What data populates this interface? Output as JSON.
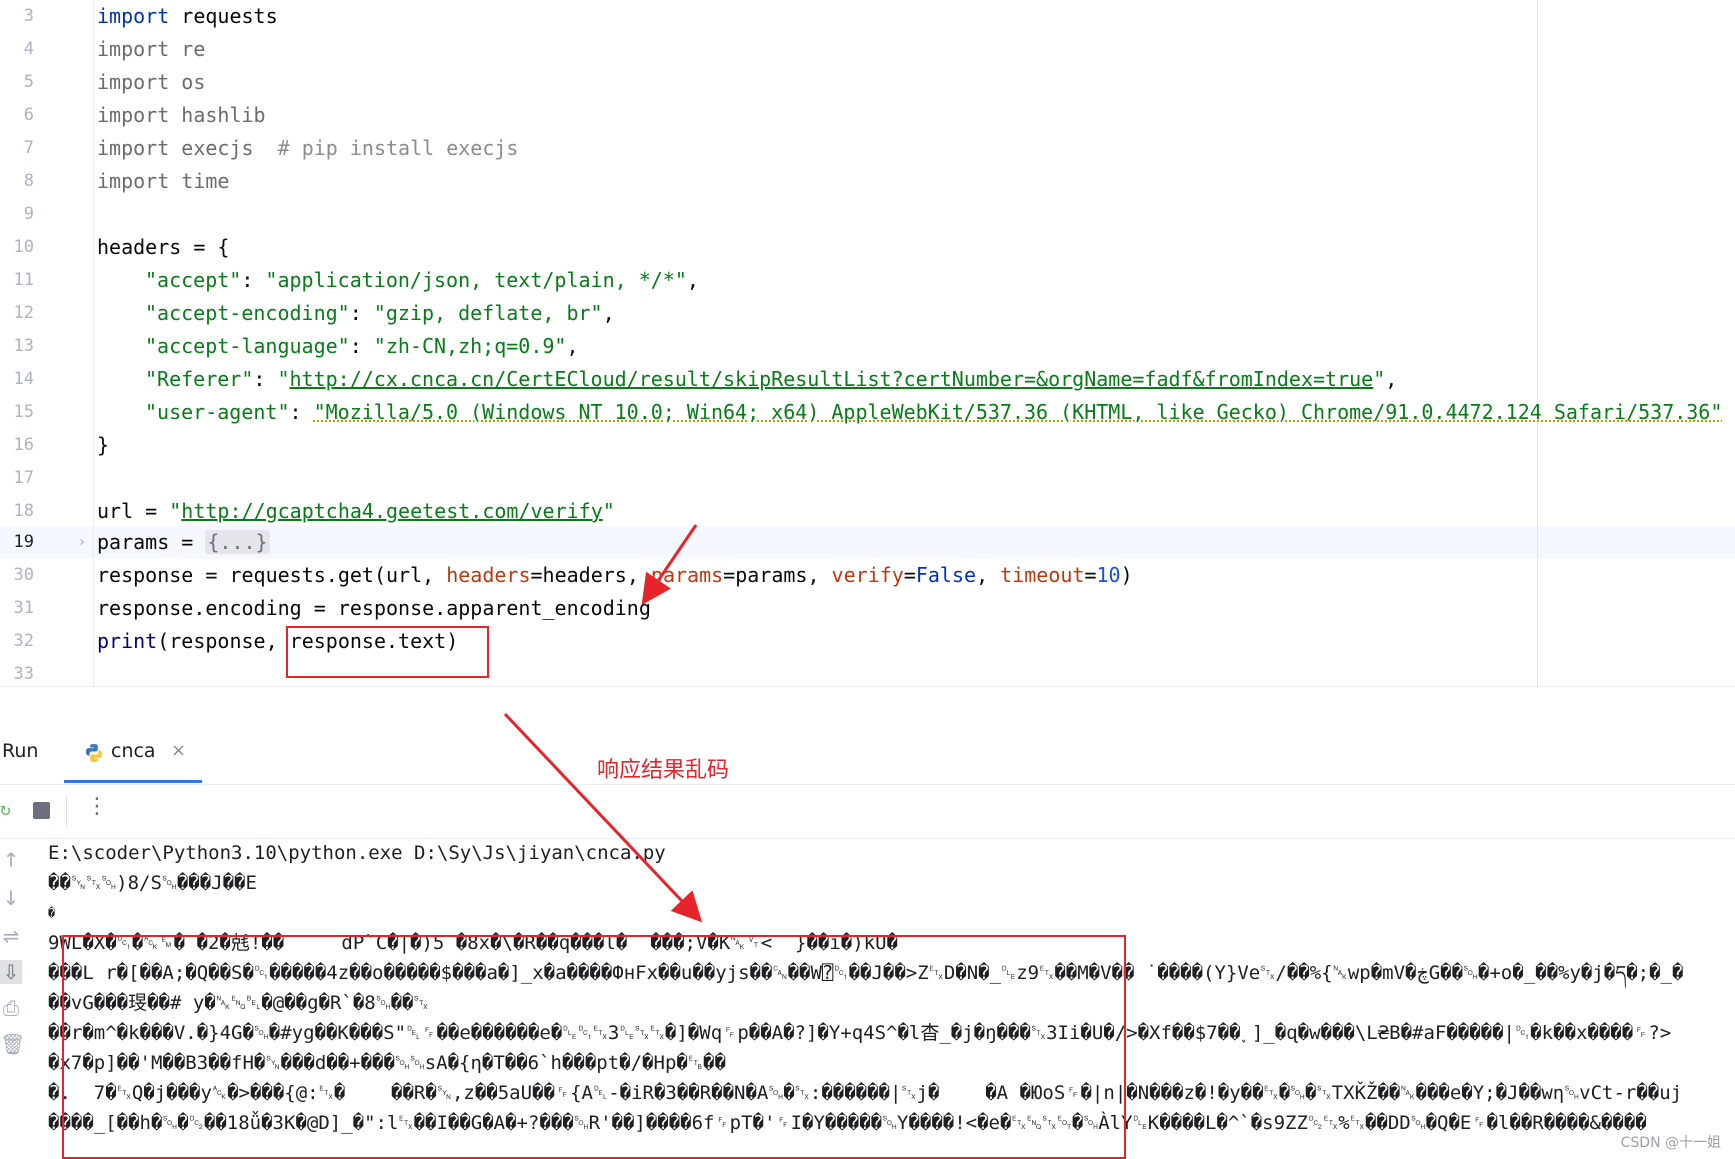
{
  "editor": {
    "line_numbers": [
      "3",
      "4",
      "5",
      "6",
      "7",
      "8",
      "9",
      "10",
      "11",
      "12",
      "13",
      "14",
      "15",
      "16",
      "17",
      "18",
      "19",
      "30",
      "31",
      "32",
      "33"
    ],
    "active_line": "19",
    "code": {
      "l3_kw": "import",
      "l3_rest": " requests",
      "l4_kw": "import",
      "l4_rest": " re",
      "l5_kw": "import",
      "l5_rest": " os",
      "l6_kw": "import",
      "l6_rest": " hashlib",
      "l7_kw": "import",
      "l7_rest": " execjs  ",
      "l7_comment": "# pip install execjs",
      "l8_kw": "import",
      "l8_rest": " time",
      "l10": "headers = {",
      "l11_key": "\"accept\"",
      "l11_sep": ": ",
      "l11_val": "\"application/json, text/plain, */*\"",
      "l11_end": ",",
      "l12_key": "\"accept-encoding\"",
      "l12_sep": ": ",
      "l12_val": "\"gzip, deflate, br\"",
      "l12_end": ",",
      "l13_key": "\"accept-language\"",
      "l13_sep": ": ",
      "l13_val": "\"zh-CN,zh;q=0.9\"",
      "l13_end": ",",
      "l14_key": "\"Referer\"",
      "l14_sep": ": ",
      "l14_q1": "\"",
      "l14_url": "http://cx.cnca.cn/CertECloud/result/skipResultList?certNumber=&orgName=fadf&fromIndex=true",
      "l14_q2": "\"",
      "l14_end": ",",
      "l15_key": "\"user-agent\"",
      "l15_sep": ": ",
      "l15_val": "\"Mozilla/5.0 (Windows NT 10.0; Win64; x64) AppleWebKit/537.36 (KHTML, like Gecko) Chrome/91.0.4472.124 Safari/537.36\"",
      "l16": "}",
      "l18_a": "url = ",
      "l18_q1": "\"",
      "l18_url": "http://gcaptcha4.geetest.com/verify",
      "l18_q2": "\"",
      "l19_a": "params = ",
      "l19_fold": "{...}",
      "l30_a": "response = requests.get(url, ",
      "l30_p1": "headers",
      "l30_b": "=headers, ",
      "l30_p2": "params",
      "l30_c": "=params, ",
      "l30_p3": "verify",
      "l30_d": "=",
      "l30_false": "False",
      "l30_e": ", ",
      "l30_p4": "timeout",
      "l30_f": "=",
      "l30_num": "10",
      "l30_g": ")",
      "l31": "response.encoding = response.apparent_encoding",
      "l32_print": "print",
      "l32_rest": "(response, response.text)"
    }
  },
  "run_panel": {
    "title": "Run",
    "tab_label": "cnca",
    "tab_close": "×",
    "rerun_icon": "rerun-icon",
    "stop_icon": "stop-icon",
    "more_label": "⋮"
  },
  "console": {
    "lines": [
      "E:\\scoder\\Python3.10\\python.exe D:\\Sy\\Js\\jiyan\\cnca.py",
      "��␖␂␁)8/S␁���J��E",
      "�",
      "9WL�X�␑�␆␙� �2�兞!��     dP`C�|�)5 �8x�\\�R��q���l�  ���;V�K␕␋<  }��i�)kU�",
      "���L r�[��A;�Q��S�␑�����4z��o�����$���a�]_x�a����ФнFx��u��yjs��␘��W⍰␑��J��>Z␃D�N�_␐z9␃��M�V�� ˙����(Y}Ve␂/��%{␕wp�mV�ڿG��␁�+o�_��%y�j�ད�;�_�",
      "��vG���琝��# y�␕␅␇�@��g�R`�8␁��␂",
      "��r�m^�k���V.�}4G�␁�#yg��K���S\"␡␌��e������e�␐␑␃3␐␂␃�]�Wq␌p��A�?]�Y+q4S^�l杳_�j�ŋ���␂3Ii�U�/>�Xf��$7��˯]_�ɋ�w���\\L₴B�#aF�����|␑�k��x����␌?>",
      "�x7�p]��'M��B3��fH�␖���d��+���␁␁sA�{η�T��6`h���pt�/�Hp�␗��",
      "�.  7�␃Q�j���y␆�>���{@:␃�    ��R�␖,z��5aU��␌{A␡-�iR�3��R��N�A␁�␂:������|␂j�    �A �ЮoS␌�|n|�N���z�!�y��␃�␁�␂TXǨŽ��␕���e�Y;�J��wη␁vCt-r��uj",
      "����_[��h�␁�␒��18ǚ�3K�@D]_�\":l␃��I��G�A�+?���␁R'��]����6f␌pT�'␌I�Y�����␁Y����!<�e�␃␅␂␄�␁ÀlY␐K����L�^`�s9ZZ␒␃%␃��DD␁�Q�E␌�l��R����&����"
    ]
  },
  "annotations": {
    "label": "响应结果乱码",
    "watermark": "CSDN @十一姐"
  }
}
